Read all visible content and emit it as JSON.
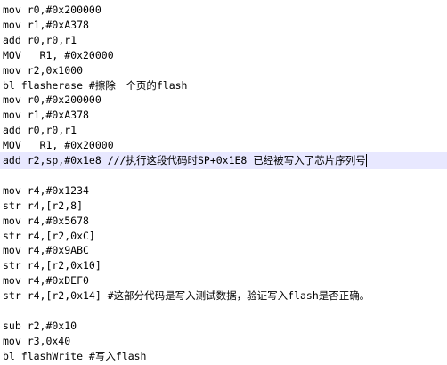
{
  "editor": {
    "current_line_index": 9,
    "current_line_color": "#e8e8ff",
    "lines": [
      "mov r0,#0x200000",
      "mov r1,#0xA378",
      "add r0,r0,r1",
      "MOV   R1, #0x20000",
      "mov r2,0x1000",
      "bl flasherase #擦除一个页的flash",
      "mov r0,#0x200000",
      "mov r1,#0xA378",
      "add r0,r0,r1",
      "MOV   R1, #0x20000",
      "add r2,sp,#0x1e8 ///执行这段代码时SP+0x1E8 已经被写入了芯片序列号",
      "",
      "mov r4,#0x1234",
      "str r4,[r2,8]",
      "mov r4,#0x5678",
      "str r4,[r2,0xC]",
      "mov r4,#0x9ABC",
      "str r4,[r2,0x10]",
      "mov r4,#0xDEF0",
      "str r4,[r2,0x14] #这部分代码是写入测试数据，验证写入flash是否正确。",
      "",
      "sub r2,#0x10",
      "mov r3,0x40",
      "bl flashWrite #写入flash"
    ]
  }
}
